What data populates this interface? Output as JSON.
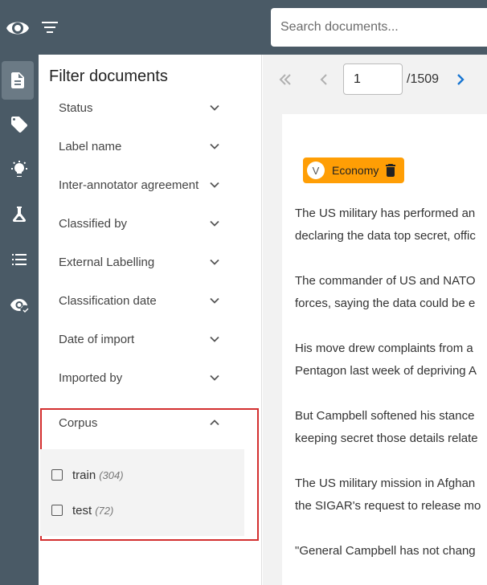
{
  "header": {
    "search_placeholder": "Search documents..."
  },
  "rail": {
    "items": [
      {
        "icon": "documents-icon",
        "active": true
      },
      {
        "icon": "tag-icon",
        "active": false
      },
      {
        "icon": "lightbulb-icon",
        "active": false
      },
      {
        "icon": "flask-icon",
        "active": false
      },
      {
        "icon": "list-icon",
        "active": false
      },
      {
        "icon": "eye-check-icon",
        "active": false
      }
    ]
  },
  "filter": {
    "title": "Filter documents",
    "sections": [
      {
        "label": "Status"
      },
      {
        "label": "Label name"
      },
      {
        "label": "Inter-annotator agreement"
      },
      {
        "label": "Classified by"
      },
      {
        "label": "External Labelling"
      },
      {
        "label": "Classification date"
      },
      {
        "label": "Date of import"
      },
      {
        "label": "Imported by"
      }
    ],
    "corpus": {
      "label": "Corpus",
      "options": [
        {
          "label": "train",
          "count": "(304)"
        },
        {
          "label": "test",
          "count": "(72)"
        }
      ]
    }
  },
  "pager": {
    "page": "1",
    "total": "/1509"
  },
  "document": {
    "label": {
      "avatar": "V",
      "text": "Economy",
      "color": "#ff9e05"
    },
    "lines": [
      "The US military has performed an",
      "declaring the data top secret, offic",
      "The commander of US and NATO",
      "forces, saying the data could be e",
      "His move drew complaints from a",
      "Pentagon last week of depriving A",
      "But Campbell softened his stance",
      "keeping secret those details relate",
      "The US military mission in Afghan",
      "the SIGAR's request to release mo",
      "\"General Campbell has not chang"
    ]
  },
  "colors": {
    "sidebar": "#4a5a66",
    "accent": "#1976d2",
    "highlight": "#d32f2f",
    "label": "#ff9e05"
  }
}
